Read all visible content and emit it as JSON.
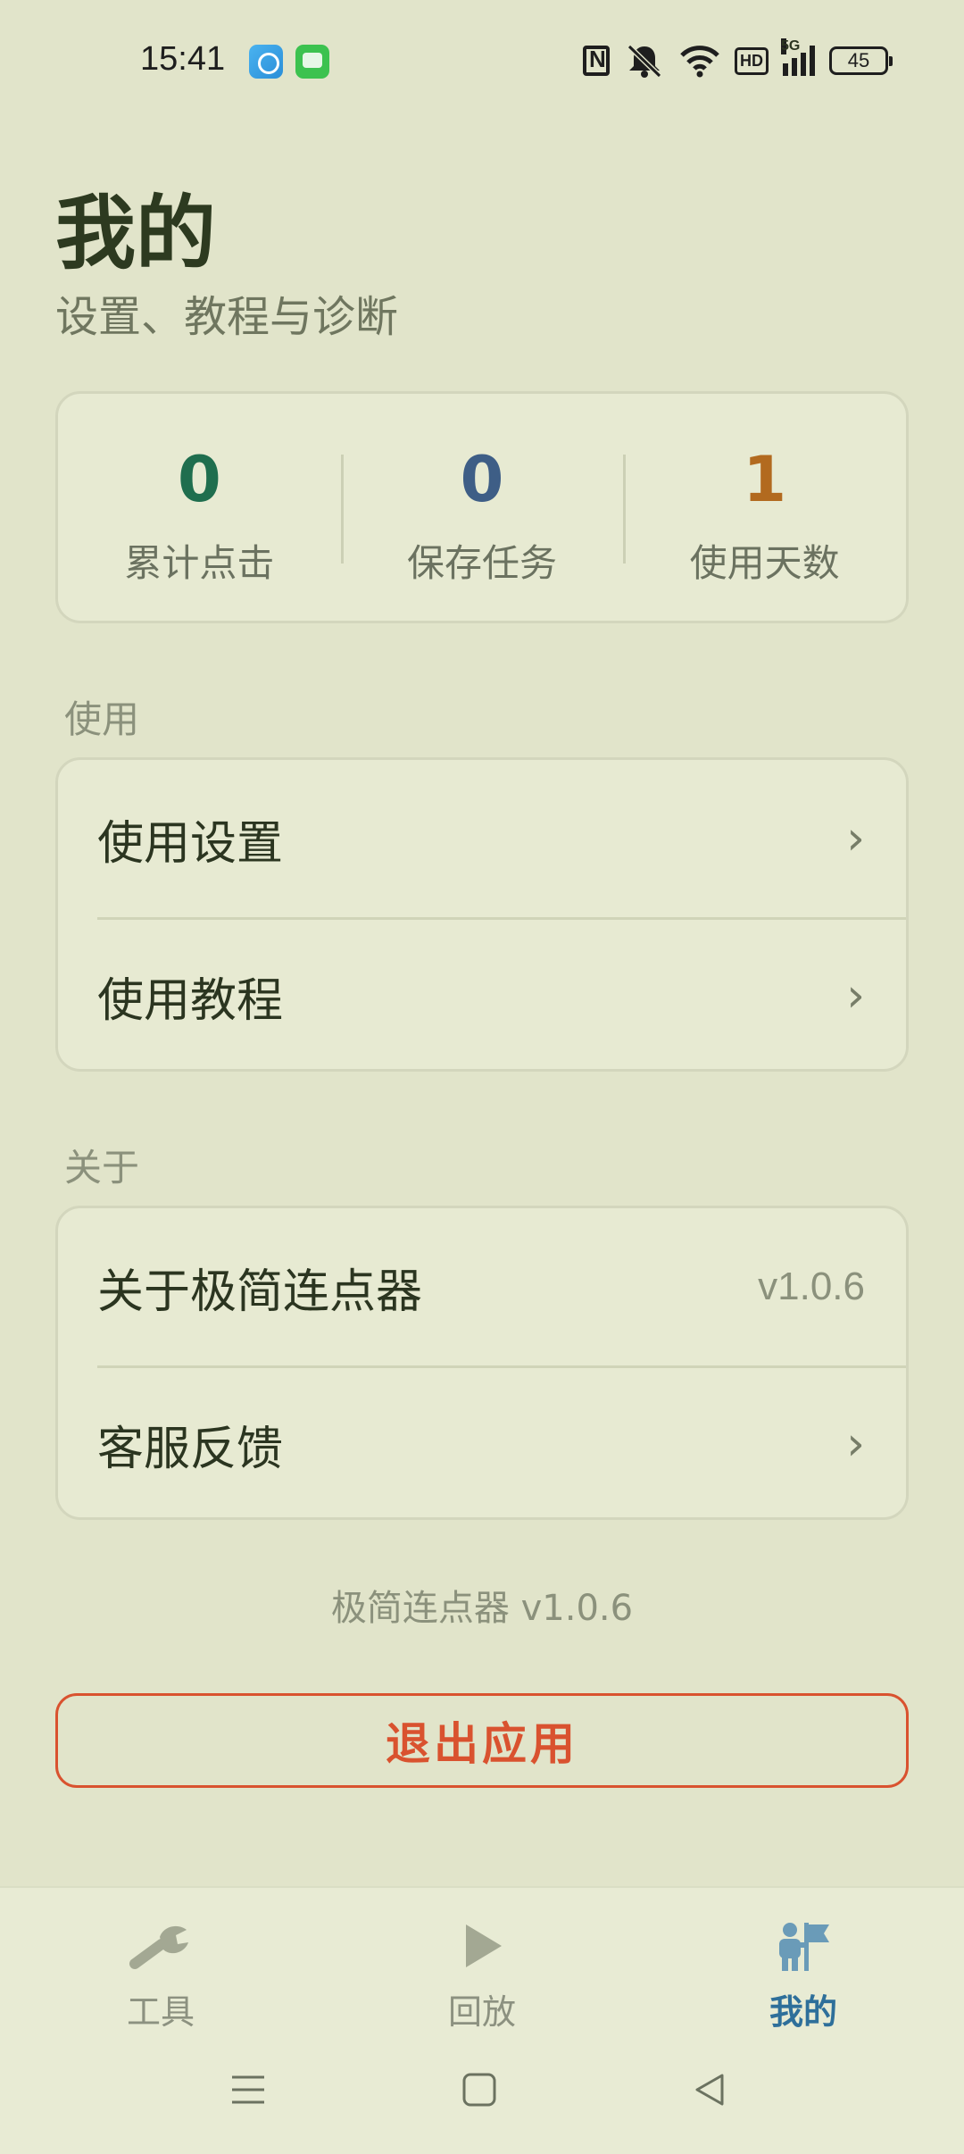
{
  "status_bar": {
    "time": "15:41",
    "network": "5G",
    "hd": "HD",
    "battery": "45",
    "icons": [
      "nfc-icon",
      "mute-bell-icon",
      "wifi-icon",
      "hd-icon",
      "signal-icon",
      "battery-icon"
    ]
  },
  "header": {
    "title": "我的",
    "subtitle": "设置、教程与诊断"
  },
  "stats": [
    {
      "value": "0",
      "label": "累计点击",
      "color": "#1f6e4e"
    },
    {
      "value": "0",
      "label": "保存任务",
      "color": "#3e5e86"
    },
    {
      "value": "1",
      "label": "使用天数",
      "color": "#b26a1f"
    }
  ],
  "sections": {
    "usage": {
      "label": "使用",
      "items": [
        {
          "label": "使用设置",
          "chevron": "›"
        },
        {
          "label": "使用教程",
          "chevron": "›"
        }
      ]
    },
    "about": {
      "label": "关于",
      "items": [
        {
          "label": "关于极简连点器",
          "value": "v1.0.6"
        },
        {
          "label": "客服反馈",
          "chevron": "›"
        }
      ]
    }
  },
  "footer": {
    "version_text": "极简连点器 v1.0.6",
    "exit_label": "退出应用"
  },
  "bottom_nav": {
    "items": [
      {
        "label": "工具",
        "icon": "wrench-icon",
        "active": false
      },
      {
        "label": "回放",
        "icon": "play-icon",
        "active": false
      },
      {
        "label": "我的",
        "icon": "person-flag-icon",
        "active": true
      }
    ],
    "active_color": "#2e6f9a",
    "inactive_color": "#8c9180"
  },
  "system_nav": [
    "menu-icon",
    "home-icon",
    "back-icon"
  ]
}
